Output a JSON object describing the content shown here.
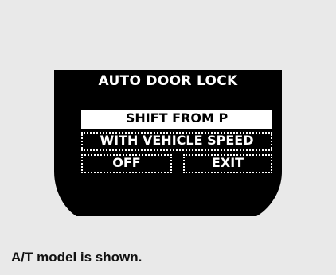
{
  "screen": {
    "title": "AUTO DOOR LOCK",
    "options": {
      "shift_from_p": "SHIFT FROM P",
      "with_vehicle_speed": "WITH VEHICLE SPEED",
      "off": "OFF",
      "exit": "EXIT"
    },
    "selected_option": "SHIFT FROM P"
  },
  "caption": "A/T model is shown.",
  "colors": {
    "background": "#e9e9e9",
    "display": "#000000",
    "text": "#ffffff",
    "highlight": "#ffffff"
  }
}
